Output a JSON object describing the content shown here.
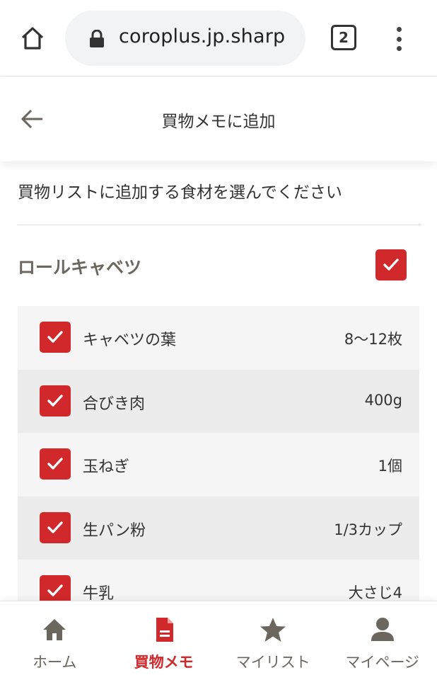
{
  "browser": {
    "url": "coroplus.jp.sharp",
    "tab_count": "2"
  },
  "header": {
    "title": "買物メモに追加"
  },
  "instruction": "買物リストに追加する食材を選んでください",
  "recipe": {
    "name": "ロールキャベツ",
    "checked": true
  },
  "ingredients": [
    {
      "name": "キャベツの葉",
      "amount": "8〜12枚",
      "checked": true
    },
    {
      "name": "合びき肉",
      "amount": "400g",
      "checked": true
    },
    {
      "name": "玉ねぎ",
      "amount": "1個",
      "checked": true
    },
    {
      "name": "生パン粉",
      "amount": "1/3カップ",
      "checked": true
    },
    {
      "name": "牛乳",
      "amount": "大さじ4",
      "checked": true
    }
  ],
  "nav": [
    {
      "label": "ホーム",
      "icon": "home-icon",
      "active": false
    },
    {
      "label": "買物メモ",
      "icon": "memo-icon",
      "active": true
    },
    {
      "label": "マイリスト",
      "icon": "star-icon",
      "active": false
    },
    {
      "label": "マイページ",
      "icon": "person-icon",
      "active": false
    }
  ],
  "colors": {
    "accent": "#d0282b",
    "muted": "#6b675e"
  }
}
